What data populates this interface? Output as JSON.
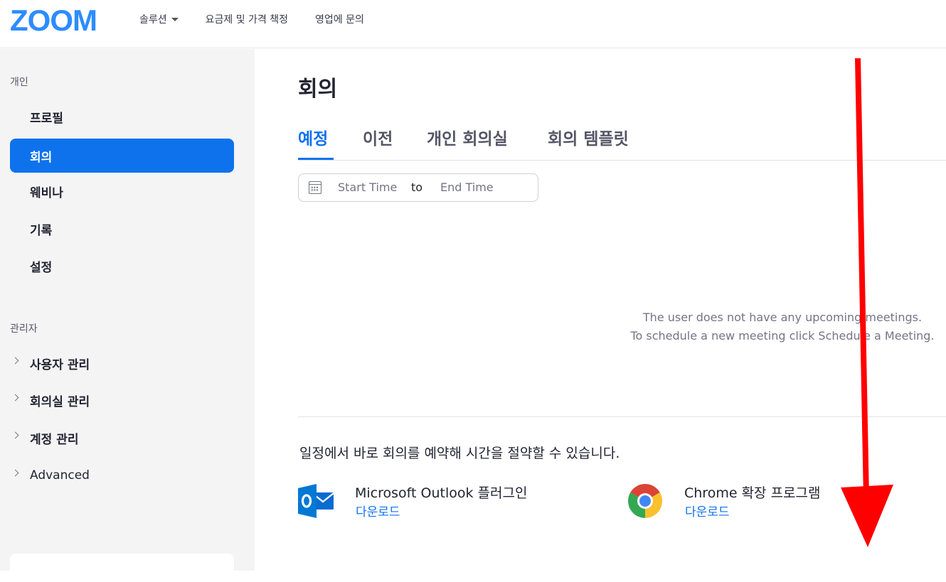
{
  "header": {
    "logo": "ZOOM",
    "nav": [
      {
        "label": "솔루션",
        "has_dropdown": true
      },
      {
        "label": "요금제 및 가격 책정"
      },
      {
        "label": "영업에 문의"
      }
    ]
  },
  "sidebar": {
    "personal_label": "개인",
    "personal_items": [
      "프로필",
      "회의",
      "웨비나",
      "기록",
      "설정"
    ],
    "active_item": "회의",
    "admin_label": "관리자",
    "admin_items": [
      "사용자 관리",
      "회의실 관리",
      "계정 관리",
      "Advanced"
    ]
  },
  "main": {
    "title": "회의",
    "tabs": [
      "예정",
      "이전",
      "개인 회의실",
      "회의 템플릿"
    ],
    "active_tab": "예정",
    "date_range": {
      "start_placeholder": "Start Time",
      "to_label": "to",
      "end_placeholder": "End Time"
    },
    "empty_line1": "The user does not have any upcoming meetings.",
    "empty_line2": "To schedule a new meeting click Schedule a Meeting.",
    "promo_text": "일정에서 바로 회의를 예약해 시간을 절약할 수 있습니다.",
    "plugins": [
      {
        "name": "Microsoft Outlook 플러그인",
        "link": "다운로드",
        "icon": "outlook-icon"
      },
      {
        "name": "Chrome 확장 프로그램",
        "link": "다운로드",
        "icon": "chrome-icon"
      }
    ]
  },
  "colors": {
    "brand": "#2d8cff",
    "accent": "#0e72ed",
    "annotation_arrow": "#ff0000"
  }
}
